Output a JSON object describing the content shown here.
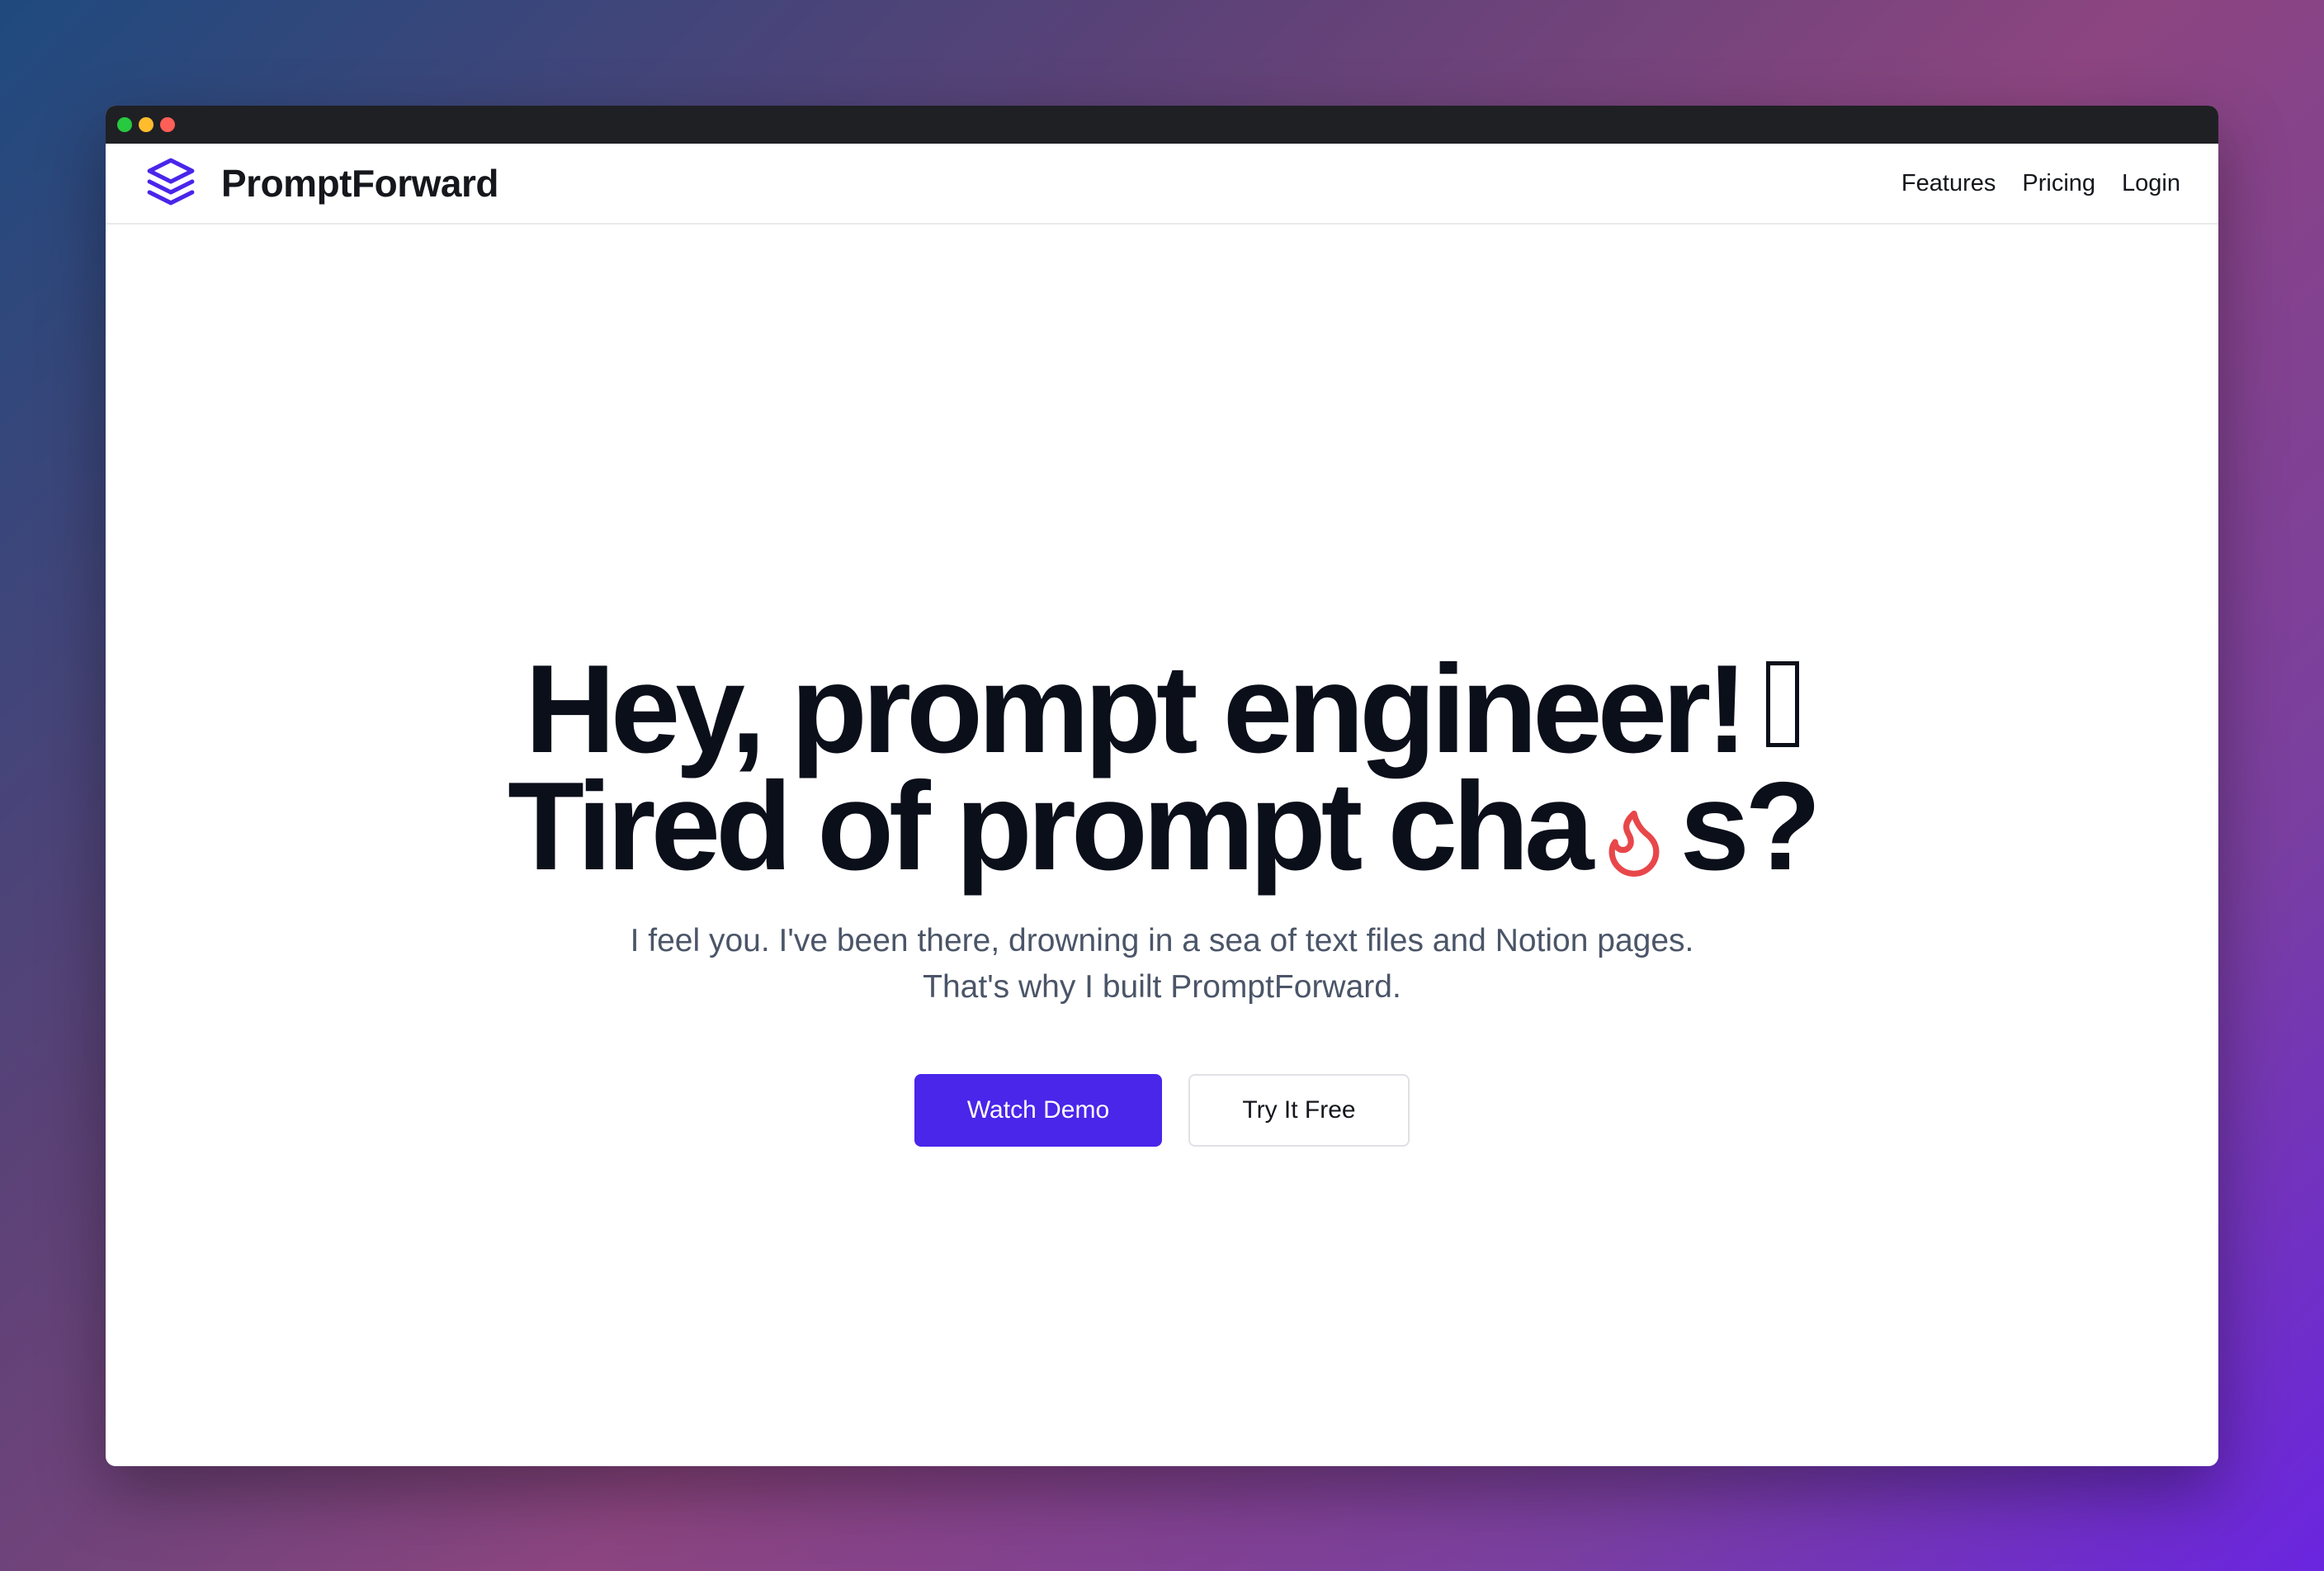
{
  "window": {
    "controls": [
      "green",
      "yellow",
      "red"
    ],
    "control_colors": [
      "#27c93f",
      "#ffbd2e",
      "#ff5f56"
    ]
  },
  "nav": {
    "brand": "PromptForward",
    "logo_icon": "layers-icon",
    "links": [
      "Features",
      "Pricing",
      "Login"
    ]
  },
  "hero": {
    "line1": "Hey, prompt engineer!",
    "line1_glyph": "wave-emoji-placeholder",
    "line2_before": "Tired of prompt cha",
    "line2_icon": "fire-icon",
    "line2_after": "s?",
    "subtext": "I feel you. I've been there, drowning in a sea of text files and Notion pages. That's why I built PromptForward.",
    "primary_button": "Watch Demo",
    "secondary_button": "Try It Free"
  },
  "colors": {
    "accent": "#4a25ea",
    "fire": "#e8474a",
    "heading": "#0b0f1a",
    "subtext": "#4b5568"
  }
}
